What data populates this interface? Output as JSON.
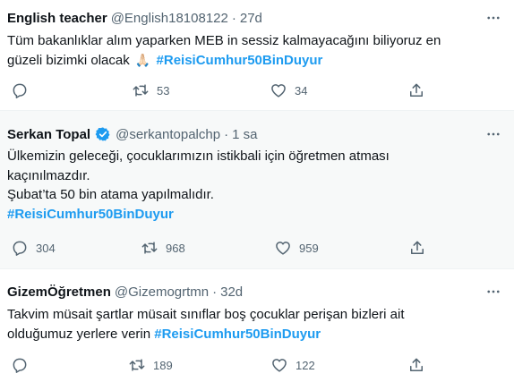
{
  "tweets": [
    {
      "name": "English teacher",
      "handle": "@English18108122",
      "dot": "·",
      "time": "27d",
      "verified": false,
      "body_lines": [
        "Tüm bakanlıklar alım yaparken MEB in sessiz kalmayacağını biliyoruz en",
        "güzeli bizimki olacak"
      ],
      "emoji": "🙏🏻",
      "hashtag": "#ReisiCumhur50BinDuyur",
      "replies": "",
      "retweets": "53",
      "likes": "34"
    },
    {
      "name": "Serkan Topal",
      "handle": "@serkantopalchp",
      "dot": "·",
      "time": "1 sa",
      "verified": true,
      "body_lines": [
        "Ülkemizin geleceği, çocuklarımızın istikbali için öğretmen atması",
        "kaçınılmazdır.",
        "Şubat’ta 50 bin atama yapılmalıdır."
      ],
      "hashtag": "#ReisiCumhur50BinDuyur",
      "replies": "304",
      "retweets": "968",
      "likes": "959"
    },
    {
      "name": "GizemÖğretmen",
      "handle": "@Gizemogrtmn",
      "dot": "·",
      "time": "32d",
      "verified": false,
      "body_lines": [
        "Takvim müsait şartlar müsait sınıflar boş çocuklar perişan bizleri ait",
        "olduğumuz yerlere verin"
      ],
      "hashtag": "#ReisiCumhur50BinDuyur",
      "replies": "",
      "retweets": "189",
      "likes": "122"
    }
  ],
  "colors": {
    "accent": "#1d9bf0",
    "muted": "#536471",
    "text": "#0f1419",
    "highlight_bg": "#f7f9f9"
  },
  "icons": [
    "more-icon",
    "reply-icon",
    "retweet-icon",
    "like-icon",
    "share-icon",
    "verified-badge-icon"
  ]
}
